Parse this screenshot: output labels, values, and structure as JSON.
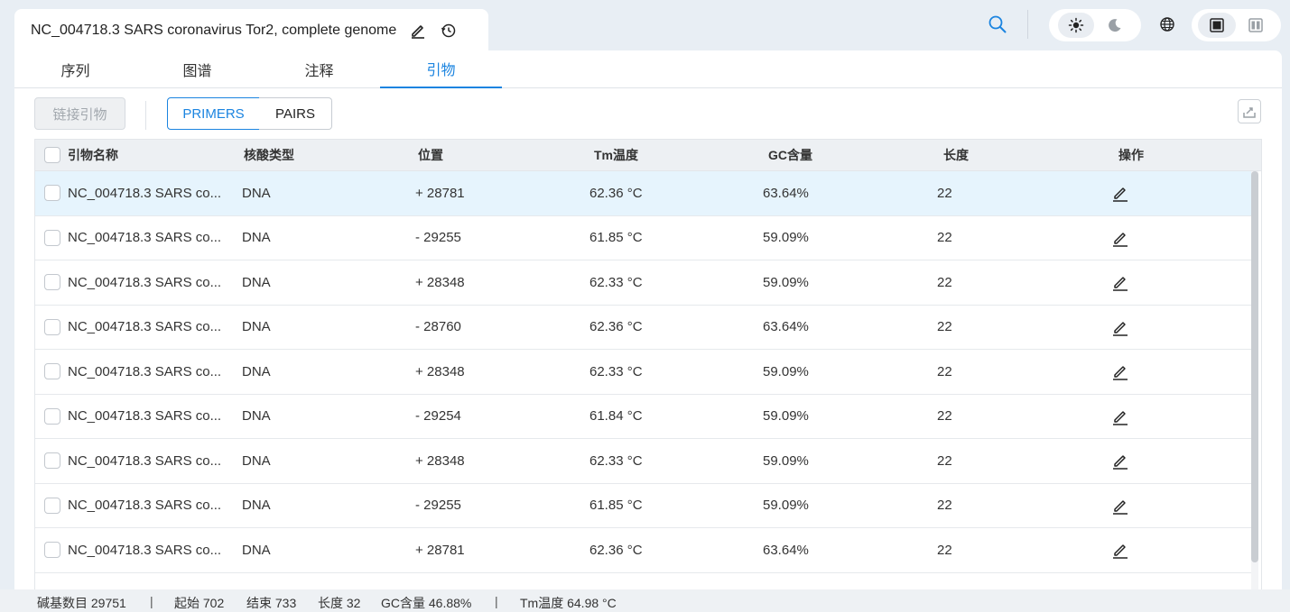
{
  "document": {
    "title": "NC_004718.3 SARS coronavirus Tor2, complete genome"
  },
  "tabs": [
    {
      "label": "序列"
    },
    {
      "label": "图谱"
    },
    {
      "label": "注释"
    },
    {
      "label": "引物",
      "active": true
    }
  ],
  "toolbar": {
    "link_primers_label": "链接引物",
    "primers_label": "PRIMERS",
    "pairs_label": "PAIRS"
  },
  "table": {
    "headers": [
      "引物名称",
      "核酸类型",
      "位置",
      "Tm温度",
      "GC含量",
      "长度",
      "操作"
    ],
    "rows": [
      {
        "name": "NC_004718.3 SARS co...",
        "type": "DNA",
        "position": "+ 28781",
        "tm": "62.36 °C",
        "gc": "63.64%",
        "length": "22"
      },
      {
        "name": "NC_004718.3 SARS co...",
        "type": "DNA",
        "position": "- 29255",
        "tm": "61.85 °C",
        "gc": "59.09%",
        "length": "22"
      },
      {
        "name": "NC_004718.3 SARS co...",
        "type": "DNA",
        "position": "+ 28348",
        "tm": "62.33 °C",
        "gc": "59.09%",
        "length": "22"
      },
      {
        "name": "NC_004718.3 SARS co...",
        "type": "DNA",
        "position": "- 28760",
        "tm": "62.36 °C",
        "gc": "63.64%",
        "length": "22"
      },
      {
        "name": "NC_004718.3 SARS co...",
        "type": "DNA",
        "position": "+ 28348",
        "tm": "62.33 °C",
        "gc": "59.09%",
        "length": "22"
      },
      {
        "name": "NC_004718.3 SARS co...",
        "type": "DNA",
        "position": "- 29254",
        "tm": "61.84 °C",
        "gc": "59.09%",
        "length": "22"
      },
      {
        "name": "NC_004718.3 SARS co...",
        "type": "DNA",
        "position": "+ 28348",
        "tm": "62.33 °C",
        "gc": "59.09%",
        "length": "22"
      },
      {
        "name": "NC_004718.3 SARS co...",
        "type": "DNA",
        "position": "- 29255",
        "tm": "61.85 °C",
        "gc": "59.09%",
        "length": "22"
      },
      {
        "name": "NC_004718.3 SARS co...",
        "type": "DNA",
        "position": "+ 28781",
        "tm": "62.36 °C",
        "gc": "63.64%",
        "length": "22"
      }
    ]
  },
  "status_bar": {
    "base_count": "碱基数目 29751",
    "start": "起始 702",
    "end": "结束 733",
    "length": "长度 32",
    "gc": "GC含量 46.88%",
    "tm": "Tm温度 64.98 °C",
    "separator": "|"
  },
  "icons": {
    "edit_title": "pencil-icon",
    "history": "history-icon",
    "search": "search-icon",
    "theme_light": "sun-icon",
    "theme_dark": "moon-icon",
    "language": "globe-icon",
    "layout_single": "single-panel-icon",
    "layout_split": "split-panel-icon",
    "export": "export-icon",
    "row_edit": "pencil-icon"
  },
  "colors": {
    "accent": "#1b84e0",
    "selected_row": "#e6f4fd",
    "background": "#e8eef4"
  }
}
